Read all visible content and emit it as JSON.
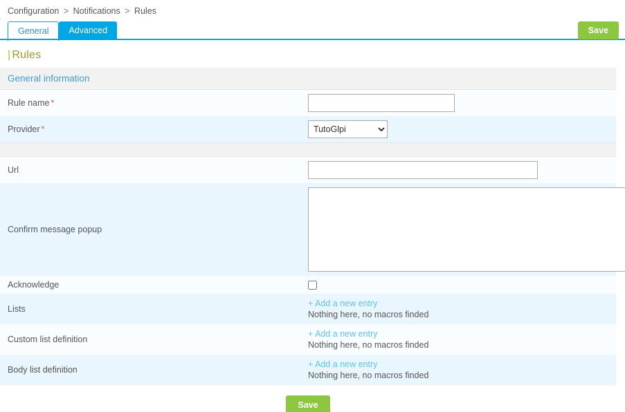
{
  "breadcrumb": {
    "items": [
      "Configuration",
      "Notifications",
      "Rules"
    ],
    "separator": ">"
  },
  "tabs": [
    {
      "label": "General",
      "active": true
    },
    {
      "label": "Advanced",
      "active": false
    }
  ],
  "toolbar": {
    "save_label": "Save"
  },
  "page": {
    "title": "Rules",
    "title_bar": "|"
  },
  "form": {
    "section_header": "General information",
    "required_marker": "*",
    "fields": {
      "rule_name": {
        "label": "Rule name",
        "required": true,
        "value": "",
        "placeholder": ""
      },
      "provider": {
        "label": "Provider",
        "required": true,
        "selected": "TutoGlpi",
        "options": [
          "TutoGlpi"
        ]
      },
      "url": {
        "label": "Url",
        "required": false,
        "value": "",
        "placeholder": ""
      },
      "confirm_message_popup": {
        "label": "Confirm message popup",
        "required": false,
        "value": "",
        "placeholder": ""
      },
      "acknowledge": {
        "label": "Acknowledge",
        "checked": false
      },
      "lists": {
        "label": "Lists",
        "add_link": "+ Add a new entry",
        "empty_text": "Nothing here, no macros finded"
      },
      "custom_list_definition": {
        "label": "Custom list definition",
        "add_link": "+ Add a new entry",
        "empty_text": "Nothing here, no macros finded"
      },
      "body_list_definition": {
        "label": "Body list definition",
        "add_link": "+ Add a new entry",
        "empty_text": "Nothing here, no macros finded"
      }
    },
    "submit_label": "Save"
  },
  "colors": {
    "accent_blue": "#00a7e5",
    "save_green": "#8dc63f",
    "title_olive": "#9a9a30",
    "required_red": "#e8564f",
    "link_blue": "#5ec2ef",
    "row_light": "#f9fdff",
    "row_alt": "#eaf6fd",
    "section_gray": "#f2f2f2"
  }
}
